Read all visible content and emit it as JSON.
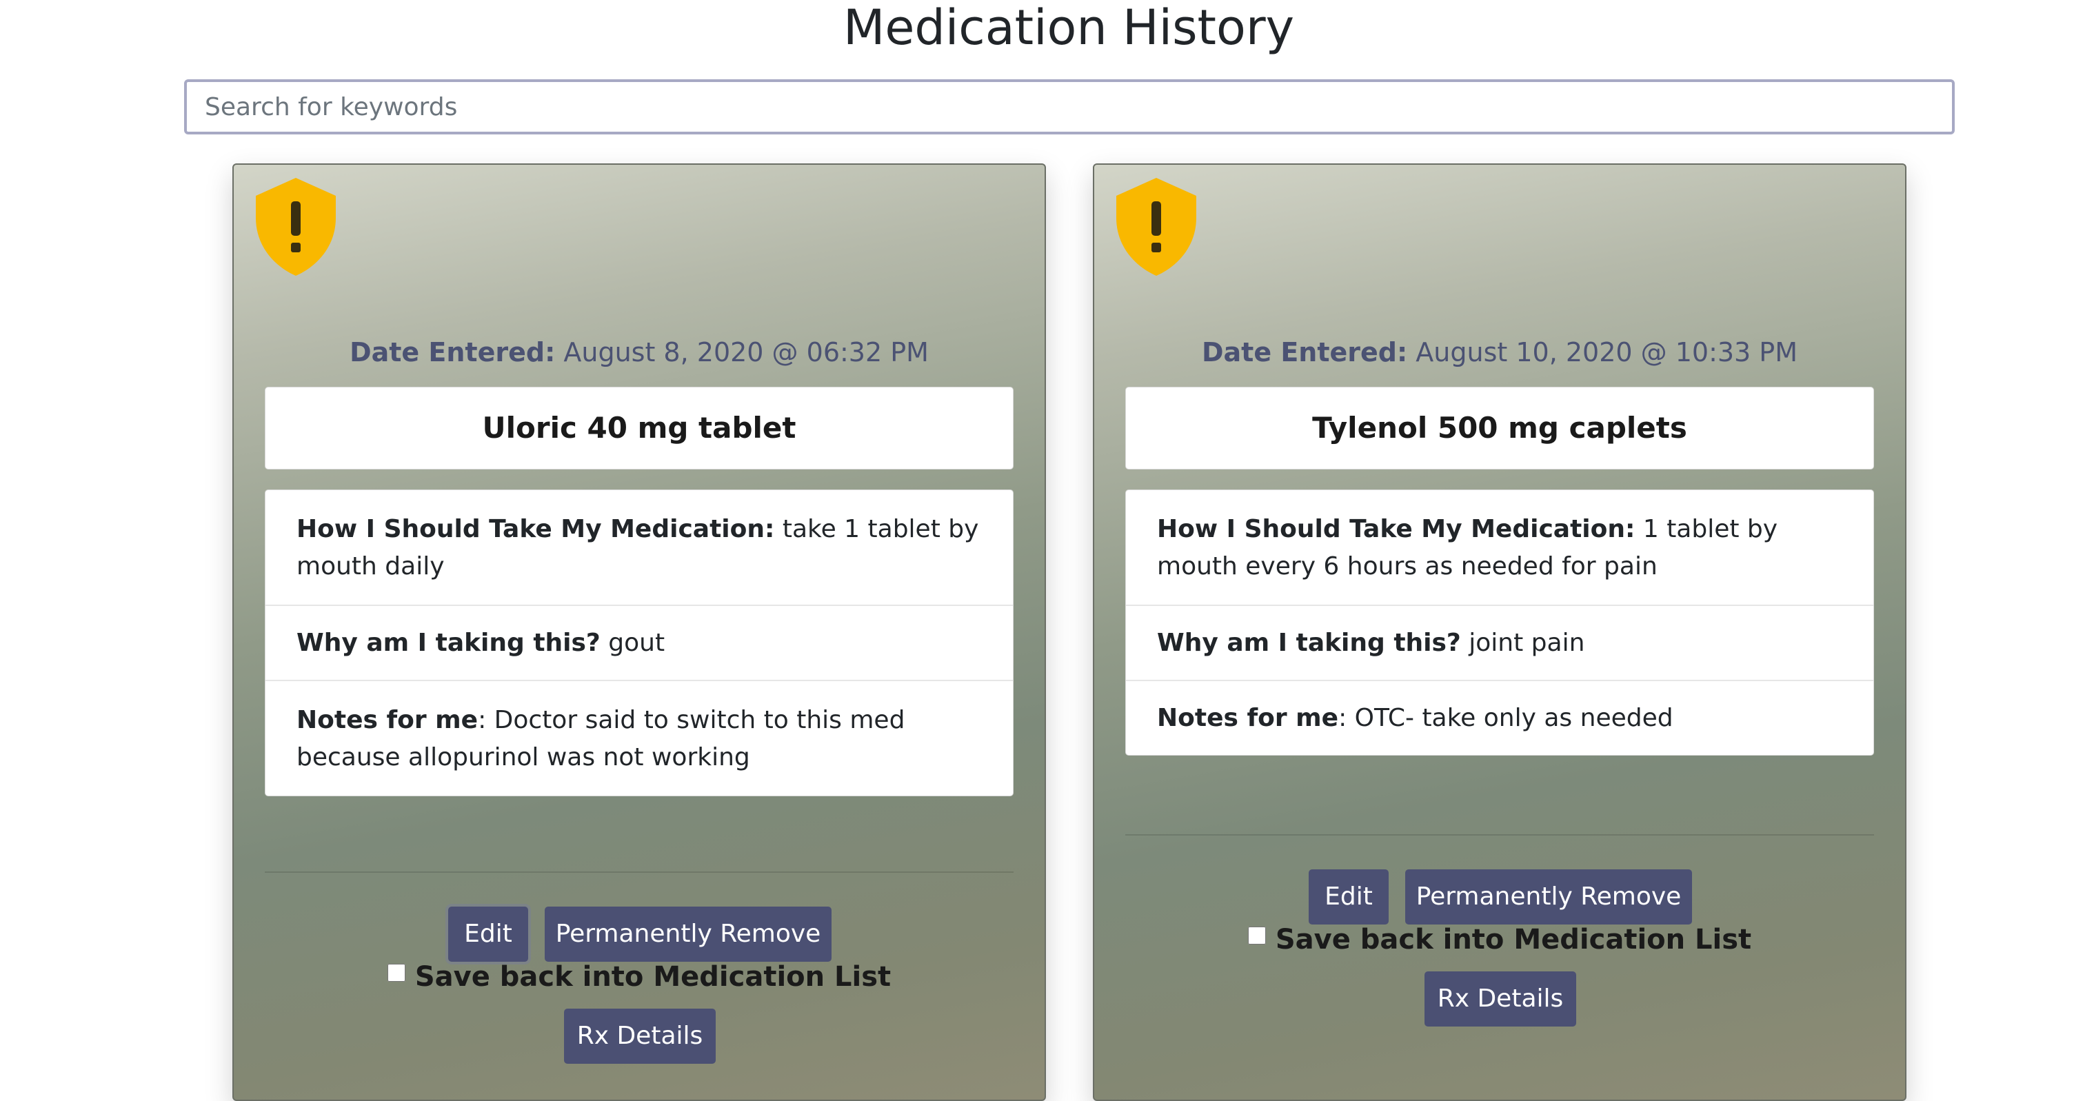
{
  "page": {
    "title": "Medication History"
  },
  "search": {
    "placeholder": "Search for keywords",
    "value": ""
  },
  "colors": {
    "button": "#4b5073",
    "date_text": "#4b5273",
    "warning_shield": "#f9b800"
  },
  "medications": [
    {
      "icon": "warning-shield-icon",
      "date_label": "Date Entered:",
      "date_value": "August 8, 2020 @ 06:32 PM",
      "name": "Uloric 40 mg tablet",
      "how_label": "How I Should Take My Medication:",
      "how_value": "take 1 tablet by mouth daily",
      "why_label": "Why am I taking this?",
      "why_value": "gout",
      "notes_label": "Notes for me",
      "notes_value": "Doctor said to switch to this med because allopurinol was not working",
      "save_label": "Save back into Medication List",
      "save_checked": false,
      "edit_label": "Edit",
      "remove_label": "Permanently Remove",
      "rx_label": "Rx Details"
    },
    {
      "icon": "warning-shield-icon",
      "date_label": "Date Entered:",
      "date_value": "August 10, 2020 @ 10:33 PM",
      "name": "Tylenol 500 mg caplets",
      "how_label": "How I Should Take My Medication:",
      "how_value": "1 tablet by mouth every 6 hours as needed for pain",
      "why_label": "Why am I taking this?",
      "why_value": "joint pain",
      "notes_label": "Notes for me",
      "notes_value": "OTC- take only as needed",
      "save_label": "Save back into Medication List",
      "save_checked": false,
      "edit_label": "Edit",
      "remove_label": "Permanently Remove",
      "rx_label": "Rx Details"
    }
  ]
}
